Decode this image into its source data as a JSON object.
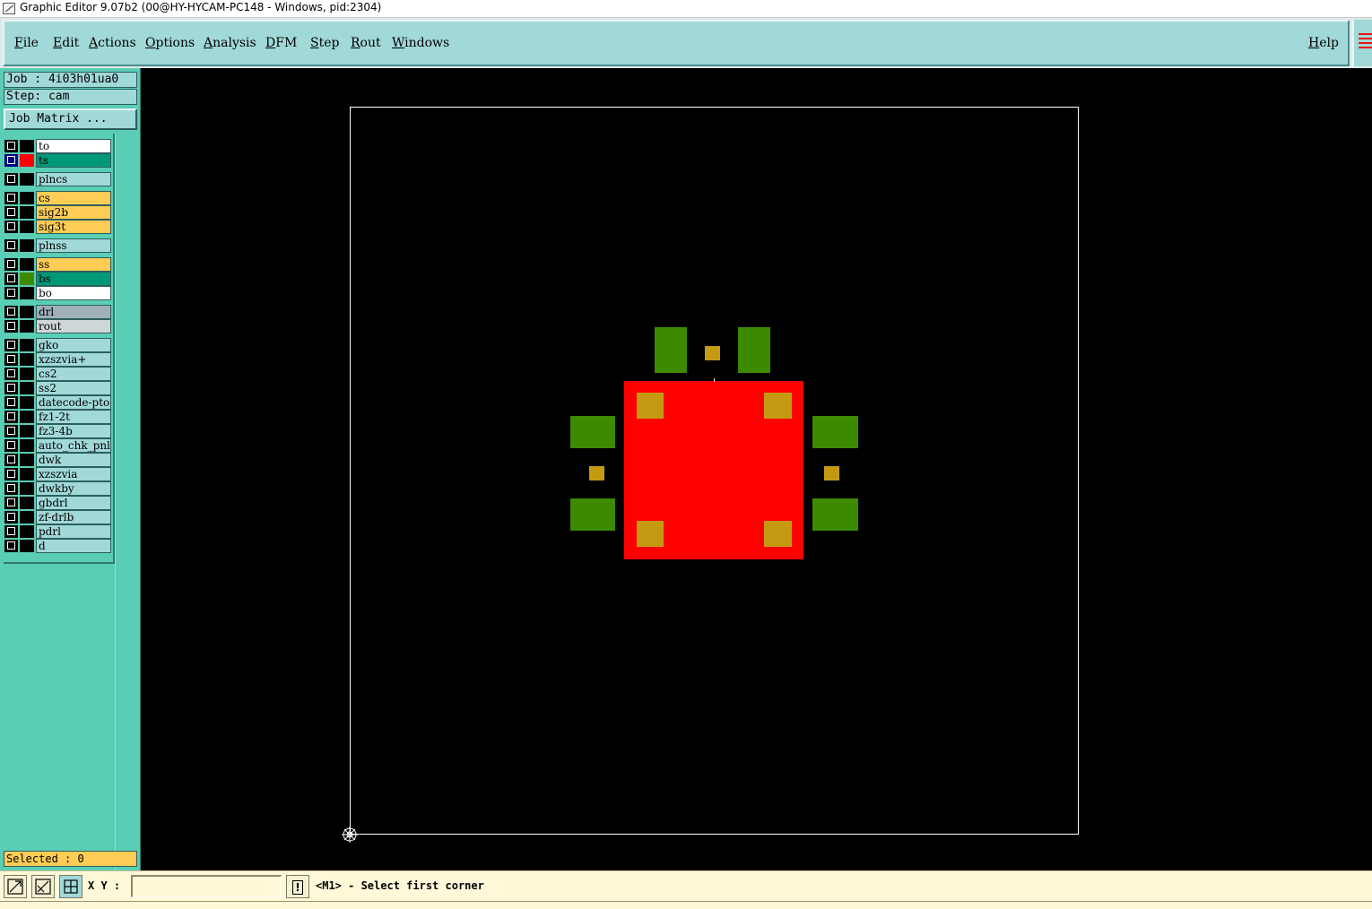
{
  "window": {
    "title": "Graphic Editor 9.07b2 (00@HY-HYCAM-PC148 - Windows, pid:2304)"
  },
  "menu": {
    "items": [
      "File",
      "Edit",
      "Actions",
      "Options",
      "Analysis",
      "DFM",
      "Step",
      "Rout",
      "Windows"
    ],
    "help": "Help"
  },
  "panel": {
    "job": "Job : 4i03h01ua0",
    "step": "Step: cam",
    "job_matrix_button": "Job Matrix ...",
    "selected": "Selected : 0"
  },
  "layers": [
    {
      "name": "to",
      "bg": "#ffffff",
      "color": "#000000",
      "active": false
    },
    {
      "name": "ts",
      "bg": "#009977",
      "color": "#ff0000",
      "active": true
    },
    {
      "name": "plncs",
      "bg": "#a1d8d8",
      "color": "#000000",
      "active": false
    },
    {
      "name": "cs",
      "bg": "#ffcc55",
      "color": "#000000",
      "active": false
    },
    {
      "name": "sig2b",
      "bg": "#ffcc55",
      "color": "#000000",
      "active": false
    },
    {
      "name": "sig3t",
      "bg": "#ffcc55",
      "color": "#000000",
      "active": false
    },
    {
      "name": "plnss",
      "bg": "#a1d8d8",
      "color": "#000000",
      "active": false
    },
    {
      "name": "ss",
      "bg": "#ffcc55",
      "color": "#000000",
      "active": false
    },
    {
      "name": "bs",
      "bg": "#009977",
      "color": "#3d8a00",
      "active": false
    },
    {
      "name": "bo",
      "bg": "#ffffff",
      "color": "#000000",
      "active": false
    },
    {
      "name": "drl",
      "bg": "#9fb0b8",
      "color": "#000000",
      "active": false
    },
    {
      "name": "rout",
      "bg": "#cfd6d8",
      "color": "#000000",
      "active": false
    },
    {
      "name": "gko",
      "bg": "#a1d8d8",
      "color": "#000000",
      "active": false
    },
    {
      "name": "xzszvia+",
      "bg": "#a1d8d8",
      "color": "#000000",
      "active": false
    },
    {
      "name": "cs2",
      "bg": "#a1d8d8",
      "color": "#000000",
      "active": false
    },
    {
      "name": "ss2",
      "bg": "#a1d8d8",
      "color": "#000000",
      "active": false
    },
    {
      "name": "datecode-pto",
      "bg": "#a1d8d8",
      "color": "#000000",
      "active": false
    },
    {
      "name": "fz1-2t",
      "bg": "#a1d8d8",
      "color": "#000000",
      "active": false
    },
    {
      "name": "fz3-4b",
      "bg": "#a1d8d8",
      "color": "#000000",
      "active": false
    },
    {
      "name": "auto_chk_pnl",
      "bg": "#a1d8d8",
      "color": "#000000",
      "active": false
    },
    {
      "name": "dwk",
      "bg": "#a1d8d8",
      "color": "#000000",
      "active": false
    },
    {
      "name": "xzszvia",
      "bg": "#a1d8d8",
      "color": "#000000",
      "active": false
    },
    {
      "name": "dwkby",
      "bg": "#a1d8d8",
      "color": "#000000",
      "active": false
    },
    {
      "name": "gbdrl",
      "bg": "#a1d8d8",
      "color": "#000000",
      "active": false
    },
    {
      "name": "zf-drlb",
      "bg": "#a1d8d8",
      "color": "#000000",
      "active": false
    },
    {
      "name": "pdrl",
      "bg": "#a1d8d8",
      "color": "#000000",
      "active": false
    },
    {
      "name": "d",
      "bg": "#a1d8d8",
      "color": "#000000",
      "active": false
    }
  ],
  "colors": {
    "canvas_bg": "#000000",
    "profile_outline": "#ffffff",
    "ts_pad": "#ff0000",
    "bs_pad": "#3d8a00",
    "drill_pad": "#c49a12"
  },
  "statusbar": {
    "xy_label": "X Y :",
    "xy_value": "",
    "message": "<M1> - Select first corner"
  },
  "icons": {
    "tool1": "zoom-area-icon",
    "tool2": "measure-icon",
    "tool3": "snap-grid-icon",
    "alert": "alert-icon",
    "origin": "origin-marker-icon"
  }
}
